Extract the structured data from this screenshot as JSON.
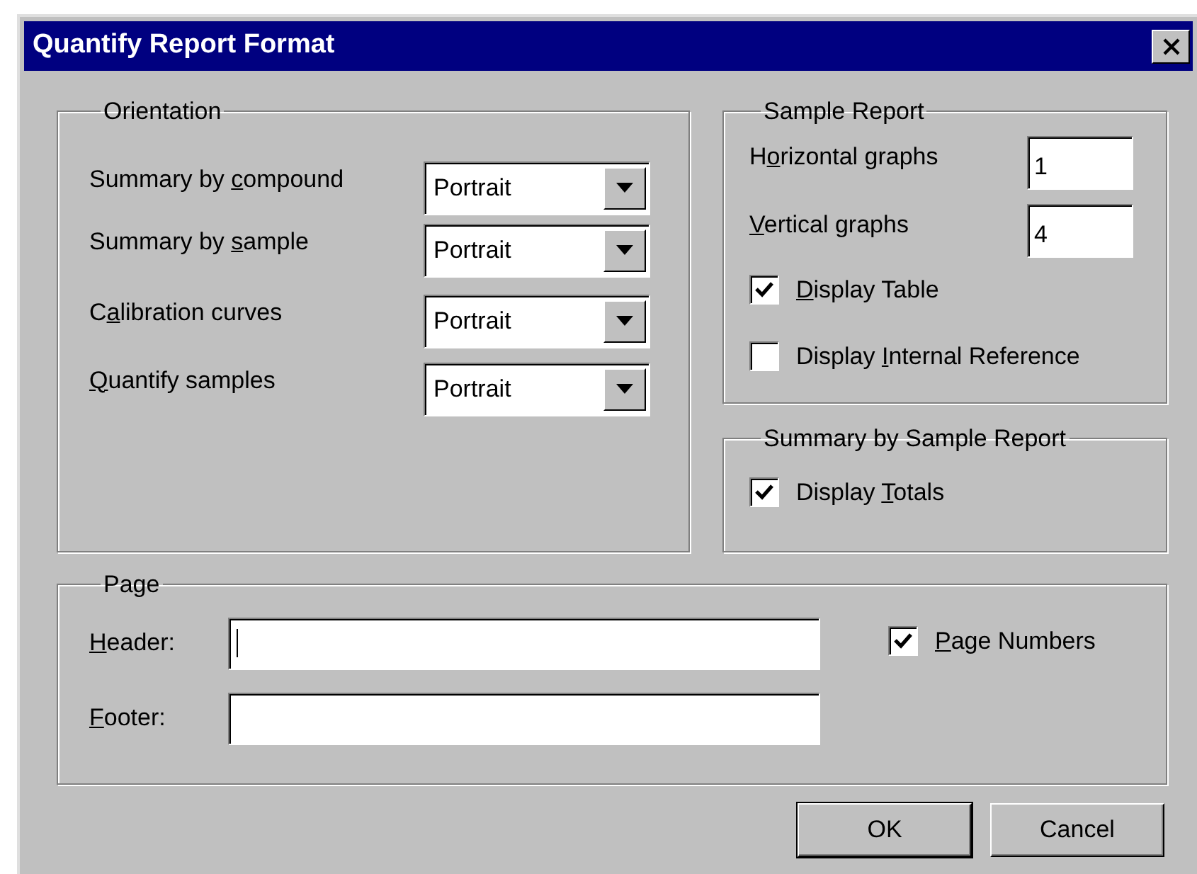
{
  "window": {
    "title": "Quantify Report Format"
  },
  "orientation": {
    "title": "Orientation",
    "rows": [
      {
        "label": {
          "pre": "Summary by ",
          "key": "c",
          "post": "ompound"
        },
        "value": "Portrait"
      },
      {
        "label": {
          "pre": "Summary by ",
          "key": "s",
          "post": "ample"
        },
        "value": "Portrait"
      },
      {
        "label": {
          "pre": "C",
          "key": "a",
          "post": "libration curves"
        },
        "value": "Portrait"
      },
      {
        "label": {
          "key": "Q",
          "post": "uantify samples"
        },
        "value": "Portrait"
      }
    ]
  },
  "sample_report": {
    "title": "Sample Report",
    "fields": [
      {
        "label": {
          "pre": "H",
          "key": "o",
          "post": "rizontal graphs"
        },
        "value": "1"
      },
      {
        "label": {
          "key": "V",
          "post": "ertical graphs"
        },
        "value": "4"
      }
    ],
    "checkboxes": [
      {
        "label": {
          "key": "D",
          "post": "isplay Table"
        },
        "checked": true
      },
      {
        "label": {
          "pre": "Display ",
          "key": "I",
          "post": "nternal Reference"
        },
        "checked": false
      }
    ]
  },
  "summary_by_sample_report": {
    "title": "Summary by Sample Report",
    "checkboxes": [
      {
        "label": {
          "pre": "Display ",
          "key": "T",
          "post": "otals"
        },
        "checked": true
      }
    ]
  },
  "page": {
    "title": "Page",
    "fields": [
      {
        "label": {
          "key": "H",
          "post": "eader:"
        },
        "focused": true
      },
      {
        "label": {
          "key": "F",
          "post": "ooter:"
        }
      }
    ],
    "checkbox": {
      "label": {
        "key": "P",
        "post": "age Numbers"
      },
      "checked": true
    }
  },
  "buttons": [
    {
      "label": "OK",
      "default": true
    },
    {
      "label": "Cancel",
      "default": false
    }
  ]
}
